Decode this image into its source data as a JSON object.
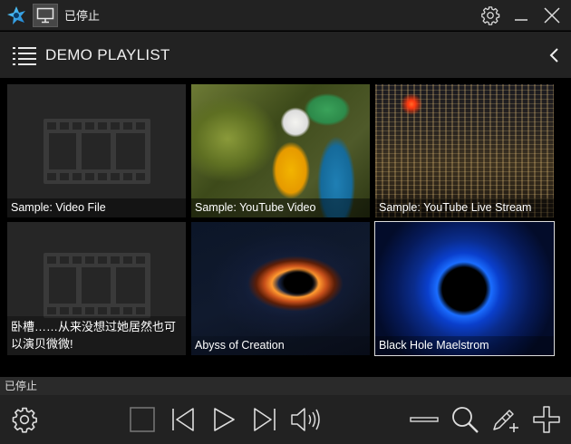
{
  "titlebar": {
    "title": "已停止",
    "icons": [
      "app-logo-icon",
      "monitor-icon",
      "gear-icon",
      "minimize-icon",
      "close-icon"
    ]
  },
  "playlist": {
    "title": "DEMO PLAYLIST",
    "items": [
      {
        "label": "Sample: Video File",
        "thumbnail": "film-placeholder"
      },
      {
        "label": "Sample: YouTube Video",
        "thumbnail": "parrot"
      },
      {
        "label": "Sample: YouTube Live Stream",
        "thumbnail": "city-night"
      },
      {
        "label": "卧槽……从来没想过她居然也可以演贝微微!",
        "thumbnail": "film-placeholder"
      },
      {
        "label": "Abyss of Creation",
        "thumbnail": "black-hole-disk"
      },
      {
        "label": "Black Hole Maelstrom",
        "thumbnail": "blue-vortex",
        "selected": true
      }
    ]
  },
  "status": {
    "text": "已停止"
  },
  "toolbar": {
    "icons": [
      "settings-icon",
      "stop-icon",
      "previous-icon",
      "play-icon",
      "next-icon",
      "volume-icon",
      "remove-icon",
      "search-icon",
      "edit-add-icon",
      "add-icon"
    ]
  },
  "colors": {
    "background": "#000000",
    "bar": "#222222",
    "accent": "#1fa8e0"
  }
}
